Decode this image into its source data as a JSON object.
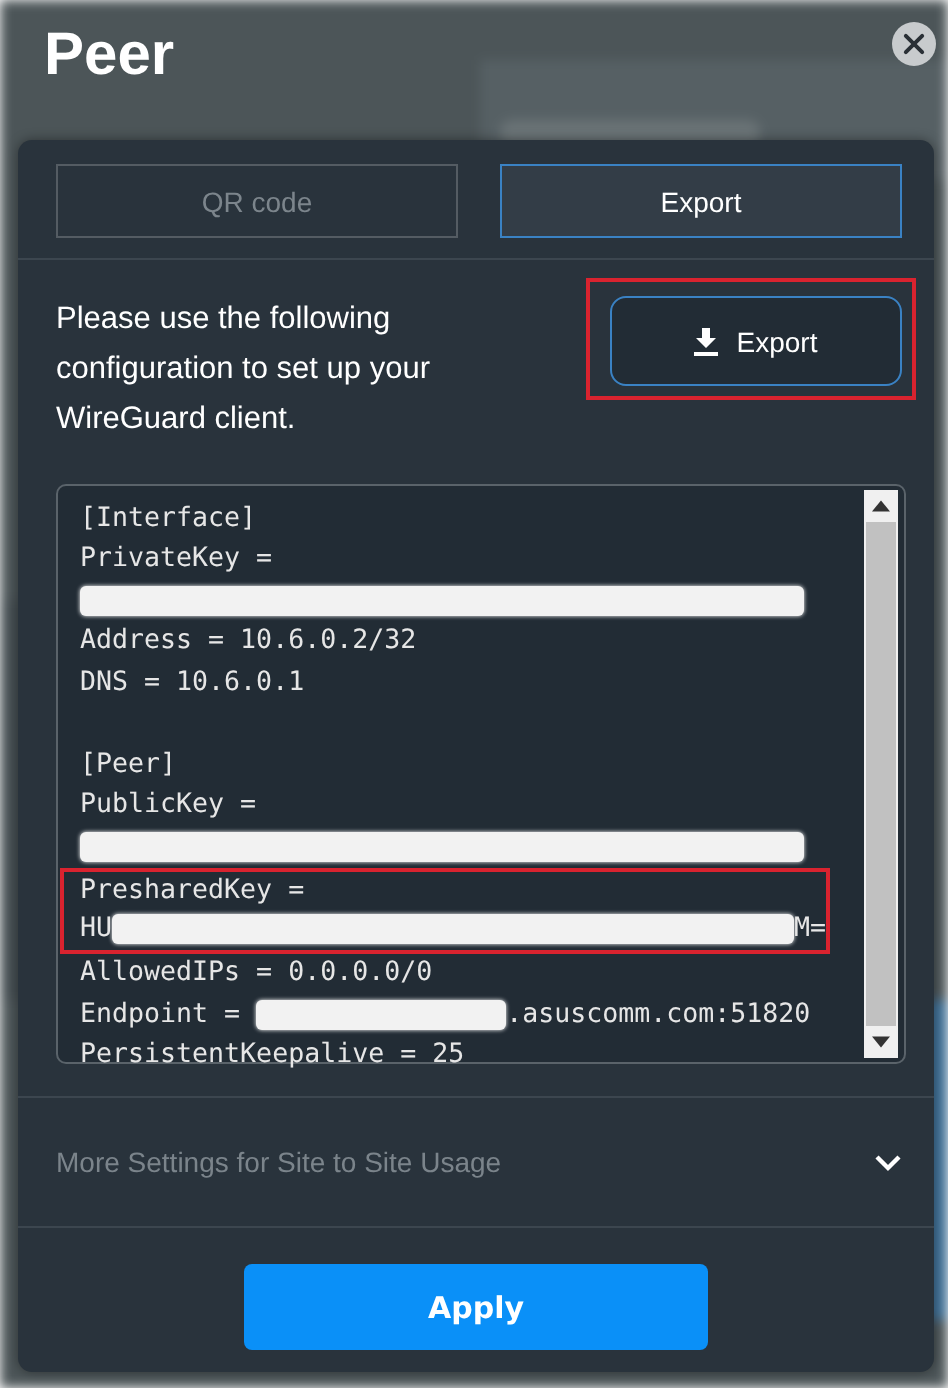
{
  "title": "Peer",
  "tabs": [
    {
      "label": "QR code",
      "selected": false
    },
    {
      "label": "Export",
      "selected": true
    }
  ],
  "description": "Please use the following configuration to set up your WireGuard client.",
  "export_button": {
    "label": "Export",
    "highlighted": true
  },
  "config_lines": [
    {
      "highlighted": false,
      "parts": [
        {
          "kind": "text",
          "text": "[Interface]"
        }
      ]
    },
    {
      "highlighted": false,
      "parts": [
        {
          "kind": "text",
          "text": "PrivateKey ="
        }
      ]
    },
    {
      "highlighted": false,
      "parts": [
        {
          "kind": "redacted"
        }
      ]
    },
    {
      "highlighted": false,
      "parts": [
        {
          "kind": "text",
          "text": "Address = 10.6.0.2/32"
        }
      ]
    },
    {
      "highlighted": false,
      "parts": [
        {
          "kind": "text",
          "text": "DNS = 10.6.0.1"
        }
      ]
    },
    {
      "highlighted": false
    },
    {
      "highlighted": false,
      "parts": [
        {
          "kind": "text",
          "text": "[Peer]"
        }
      ]
    },
    {
      "highlighted": false,
      "parts": [
        {
          "kind": "text",
          "text": "PublicKey ="
        }
      ]
    },
    {
      "highlighted": false,
      "parts": [
        {
          "kind": "redacted"
        }
      ]
    },
    {
      "highlighted": true,
      "parts": [
        {
          "kind": "text",
          "text": "PresharedKey ="
        }
      ]
    },
    {
      "highlighted": true,
      "parts": [
        {
          "kind": "text",
          "text": "HU"
        },
        {
          "kind": "redacted"
        },
        {
          "kind": "text",
          "text": "M="
        }
      ]
    },
    {
      "highlighted": false,
      "parts": [
        {
          "kind": "text",
          "text": "AllowedIPs = 0.0.0.0/0"
        }
      ]
    },
    {
      "highlighted": false,
      "parts": [
        {
          "kind": "text",
          "text": "Endpoint = "
        },
        {
          "kind": "redacted"
        },
        {
          "kind": "text",
          "text": ".asuscomm.com:51820"
        }
      ]
    },
    {
      "highlighted": false,
      "parts": [
        {
          "kind": "text",
          "text": "PersistentKeepalive = 25"
        }
      ]
    }
  ],
  "more_settings": {
    "label": "More Settings for Site to Site Usage",
    "expanded": false
  },
  "apply_button": {
    "label": "Apply"
  }
}
